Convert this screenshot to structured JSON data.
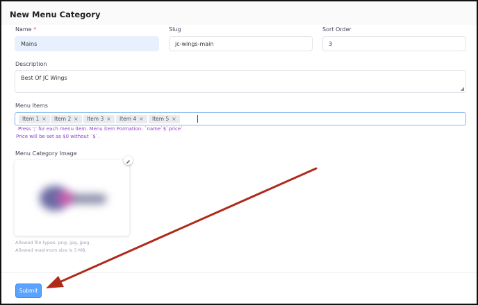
{
  "page": {
    "title": "New Menu Category"
  },
  "form": {
    "name_label": "Name",
    "required_marker": "*",
    "name_value": "Mains",
    "slug_label": "Slug",
    "slug_value": "jc-wings-main",
    "sort_label": "Sort Order",
    "sort_value": "3",
    "description_label": "Description",
    "description_value": "Best Of JC Wings",
    "menu_items_label": "Menu Items",
    "tag_remove_glyph": "×",
    "menu_items": [
      "Item 1",
      "Item 2",
      "Item 3",
      "Item 4",
      "Item 5"
    ],
    "hint_line1": "Press ';' for each menu item. Menu item Formation: `name`$`price`",
    "hint_line2": "Price will be set as $0 without `$`.",
    "image_label": "Menu Category Image",
    "allowed_types": "Allowed file types: png, jpg, jpeg.",
    "max_size": "Allowed maximum size is 3 MB."
  },
  "actions": {
    "submit_label": "Submit"
  },
  "colors": {
    "accent": "#5aa3ff",
    "annotation_arrow": "#b02a1a",
    "hint": "#8a3fc7"
  },
  "icons": {
    "edit": "pencil-icon",
    "remove_tag": "close-icon",
    "resize": "resize-handle-icon"
  }
}
